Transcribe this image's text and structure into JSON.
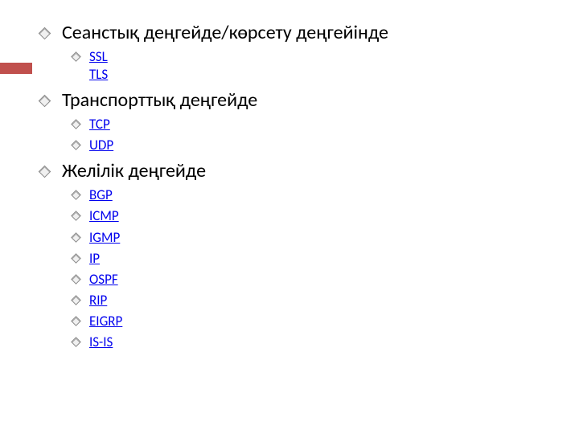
{
  "sections": [
    {
      "heading": "Сеанстық деңгейде/көрсету деңгейінде",
      "items": [
        "SSL",
        "TLS"
      ]
    },
    {
      "heading": "Транспорттық деңгейде",
      "items": [
        "TCP",
        "UDP"
      ]
    },
    {
      "heading": "Желілік деңгейде",
      "items": [
        "BGP",
        "ICMP",
        "IGMP",
        "IP",
        "OSPF",
        "RIP",
        "EIGRP",
        "IS-IS"
      ]
    }
  ]
}
